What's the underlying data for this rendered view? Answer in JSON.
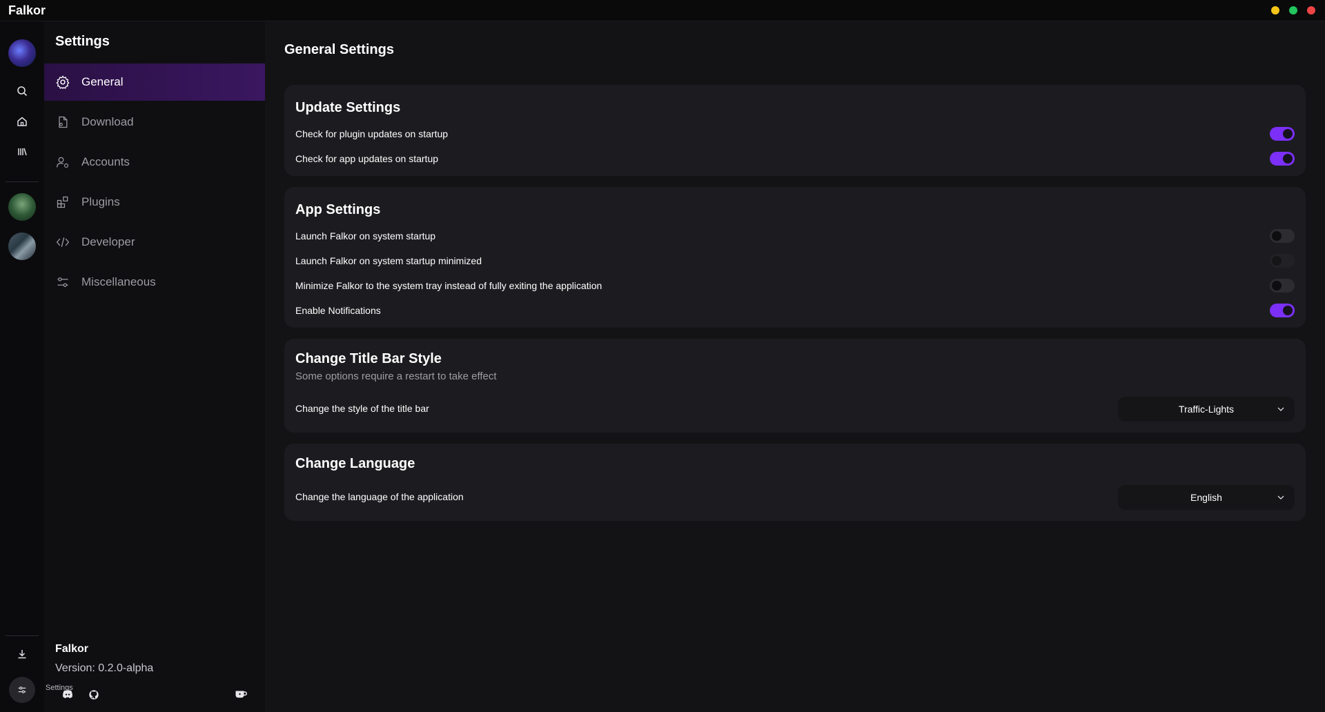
{
  "window": {
    "title": "Falkor",
    "controls": {
      "minimize_color": "#f5c518",
      "maximize_color": "#22c55e",
      "close_color": "#ef4444"
    }
  },
  "rail": {
    "items": [
      "search-icon",
      "home-icon",
      "library-icon",
      "download-icon",
      "settings-sliders-icon"
    ]
  },
  "sidebar": {
    "title": "Settings",
    "items": [
      {
        "label": "General",
        "icon": "gear-icon",
        "active": true
      },
      {
        "label": "Download",
        "icon": "file-download-icon",
        "active": false
      },
      {
        "label": "Accounts",
        "icon": "user-gear-icon",
        "active": false
      },
      {
        "label": "Plugins",
        "icon": "blocks-icon",
        "active": false
      },
      {
        "label": "Developer",
        "icon": "code-icon",
        "active": false
      },
      {
        "label": "Miscellaneous",
        "icon": "sliders-icon",
        "active": false
      }
    ],
    "footer": {
      "name": "Falkor",
      "version": "Version: 0.2.0-alpha",
      "settings_label": "Settings"
    }
  },
  "main": {
    "title": "General Settings",
    "update": {
      "title": "Update Settings",
      "rows": [
        {
          "label": "Check for plugin updates on startup",
          "enabled": true
        },
        {
          "label": "Check for app updates on startup",
          "enabled": true
        }
      ]
    },
    "app": {
      "title": "App Settings",
      "rows": [
        {
          "label": "Launch Falkor on system startup",
          "enabled": false
        },
        {
          "label": "Launch Falkor on system startup minimized",
          "enabled": false
        },
        {
          "label": "Minimize Falkor to the system tray instead of fully exiting the application",
          "enabled": false
        },
        {
          "label": "Enable Notifications",
          "enabled": true
        }
      ]
    },
    "titlebar_style": {
      "title": "Change Title Bar Style",
      "subtitle": "Some options require a restart to take effect",
      "label": "Change the style of the title bar",
      "value": "Traffic-Lights"
    },
    "language": {
      "title": "Change Language",
      "label": "Change the language of the application",
      "value": "English"
    }
  },
  "colors": {
    "accent": "#7b2ff7",
    "active_nav": "#3a1760"
  }
}
